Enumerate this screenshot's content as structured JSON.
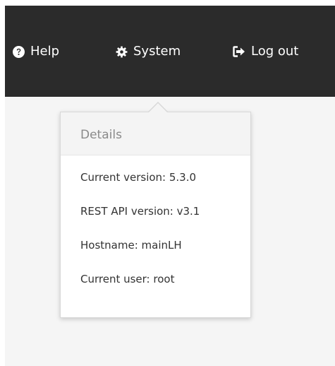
{
  "nav": {
    "help": {
      "label": "Help",
      "icon": "question-circle-icon"
    },
    "system": {
      "label": "System",
      "icon": "gear-icon"
    },
    "logout": {
      "label": "Log out",
      "icon": "sign-out-icon"
    }
  },
  "details": {
    "title": "Details",
    "rows": [
      "Current version: 5.3.0",
      "REST API version: v3.1",
      "Hostname: mainLH",
      "Current user: root"
    ]
  },
  "colors": {
    "topbar": "#2b2b2b",
    "background": "#f5f5f5",
    "popover_header": "#f4f4f4",
    "title_text": "#8a8a8a",
    "body_text": "#333333"
  }
}
